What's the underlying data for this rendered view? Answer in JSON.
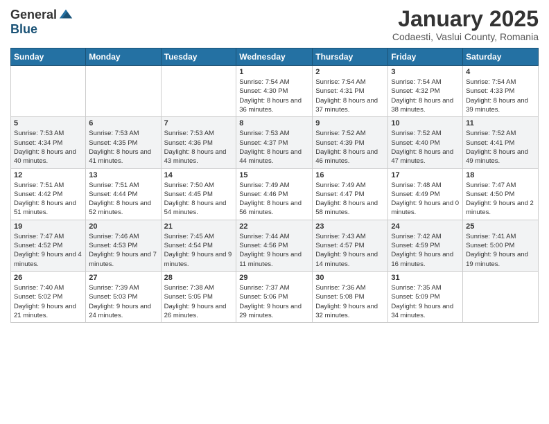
{
  "logo": {
    "general": "General",
    "blue": "Blue"
  },
  "title": "January 2025",
  "subtitle": "Codaesti, Vaslui County, Romania",
  "days_of_week": [
    "Sunday",
    "Monday",
    "Tuesday",
    "Wednesday",
    "Thursday",
    "Friday",
    "Saturday"
  ],
  "weeks": [
    [
      {
        "day": "",
        "info": ""
      },
      {
        "day": "",
        "info": ""
      },
      {
        "day": "",
        "info": ""
      },
      {
        "day": "1",
        "info": "Sunrise: 7:54 AM\nSunset: 4:30 PM\nDaylight: 8 hours and 36 minutes."
      },
      {
        "day": "2",
        "info": "Sunrise: 7:54 AM\nSunset: 4:31 PM\nDaylight: 8 hours and 37 minutes."
      },
      {
        "day": "3",
        "info": "Sunrise: 7:54 AM\nSunset: 4:32 PM\nDaylight: 8 hours and 38 minutes."
      },
      {
        "day": "4",
        "info": "Sunrise: 7:54 AM\nSunset: 4:33 PM\nDaylight: 8 hours and 39 minutes."
      }
    ],
    [
      {
        "day": "5",
        "info": "Sunrise: 7:53 AM\nSunset: 4:34 PM\nDaylight: 8 hours and 40 minutes."
      },
      {
        "day": "6",
        "info": "Sunrise: 7:53 AM\nSunset: 4:35 PM\nDaylight: 8 hours and 41 minutes."
      },
      {
        "day": "7",
        "info": "Sunrise: 7:53 AM\nSunset: 4:36 PM\nDaylight: 8 hours and 43 minutes."
      },
      {
        "day": "8",
        "info": "Sunrise: 7:53 AM\nSunset: 4:37 PM\nDaylight: 8 hours and 44 minutes."
      },
      {
        "day": "9",
        "info": "Sunrise: 7:52 AM\nSunset: 4:39 PM\nDaylight: 8 hours and 46 minutes."
      },
      {
        "day": "10",
        "info": "Sunrise: 7:52 AM\nSunset: 4:40 PM\nDaylight: 8 hours and 47 minutes."
      },
      {
        "day": "11",
        "info": "Sunrise: 7:52 AM\nSunset: 4:41 PM\nDaylight: 8 hours and 49 minutes."
      }
    ],
    [
      {
        "day": "12",
        "info": "Sunrise: 7:51 AM\nSunset: 4:42 PM\nDaylight: 8 hours and 51 minutes."
      },
      {
        "day": "13",
        "info": "Sunrise: 7:51 AM\nSunset: 4:44 PM\nDaylight: 8 hours and 52 minutes."
      },
      {
        "day": "14",
        "info": "Sunrise: 7:50 AM\nSunset: 4:45 PM\nDaylight: 8 hours and 54 minutes."
      },
      {
        "day": "15",
        "info": "Sunrise: 7:49 AM\nSunset: 4:46 PM\nDaylight: 8 hours and 56 minutes."
      },
      {
        "day": "16",
        "info": "Sunrise: 7:49 AM\nSunset: 4:47 PM\nDaylight: 8 hours and 58 minutes."
      },
      {
        "day": "17",
        "info": "Sunrise: 7:48 AM\nSunset: 4:49 PM\nDaylight: 9 hours and 0 minutes."
      },
      {
        "day": "18",
        "info": "Sunrise: 7:47 AM\nSunset: 4:50 PM\nDaylight: 9 hours and 2 minutes."
      }
    ],
    [
      {
        "day": "19",
        "info": "Sunrise: 7:47 AM\nSunset: 4:52 PM\nDaylight: 9 hours and 4 minutes."
      },
      {
        "day": "20",
        "info": "Sunrise: 7:46 AM\nSunset: 4:53 PM\nDaylight: 9 hours and 7 minutes."
      },
      {
        "day": "21",
        "info": "Sunrise: 7:45 AM\nSunset: 4:54 PM\nDaylight: 9 hours and 9 minutes."
      },
      {
        "day": "22",
        "info": "Sunrise: 7:44 AM\nSunset: 4:56 PM\nDaylight: 9 hours and 11 minutes."
      },
      {
        "day": "23",
        "info": "Sunrise: 7:43 AM\nSunset: 4:57 PM\nDaylight: 9 hours and 14 minutes."
      },
      {
        "day": "24",
        "info": "Sunrise: 7:42 AM\nSunset: 4:59 PM\nDaylight: 9 hours and 16 minutes."
      },
      {
        "day": "25",
        "info": "Sunrise: 7:41 AM\nSunset: 5:00 PM\nDaylight: 9 hours and 19 minutes."
      }
    ],
    [
      {
        "day": "26",
        "info": "Sunrise: 7:40 AM\nSunset: 5:02 PM\nDaylight: 9 hours and 21 minutes."
      },
      {
        "day": "27",
        "info": "Sunrise: 7:39 AM\nSunset: 5:03 PM\nDaylight: 9 hours and 24 minutes."
      },
      {
        "day": "28",
        "info": "Sunrise: 7:38 AM\nSunset: 5:05 PM\nDaylight: 9 hours and 26 minutes."
      },
      {
        "day": "29",
        "info": "Sunrise: 7:37 AM\nSunset: 5:06 PM\nDaylight: 9 hours and 29 minutes."
      },
      {
        "day": "30",
        "info": "Sunrise: 7:36 AM\nSunset: 5:08 PM\nDaylight: 9 hours and 32 minutes."
      },
      {
        "day": "31",
        "info": "Sunrise: 7:35 AM\nSunset: 5:09 PM\nDaylight: 9 hours and 34 minutes."
      },
      {
        "day": "",
        "info": ""
      }
    ]
  ]
}
